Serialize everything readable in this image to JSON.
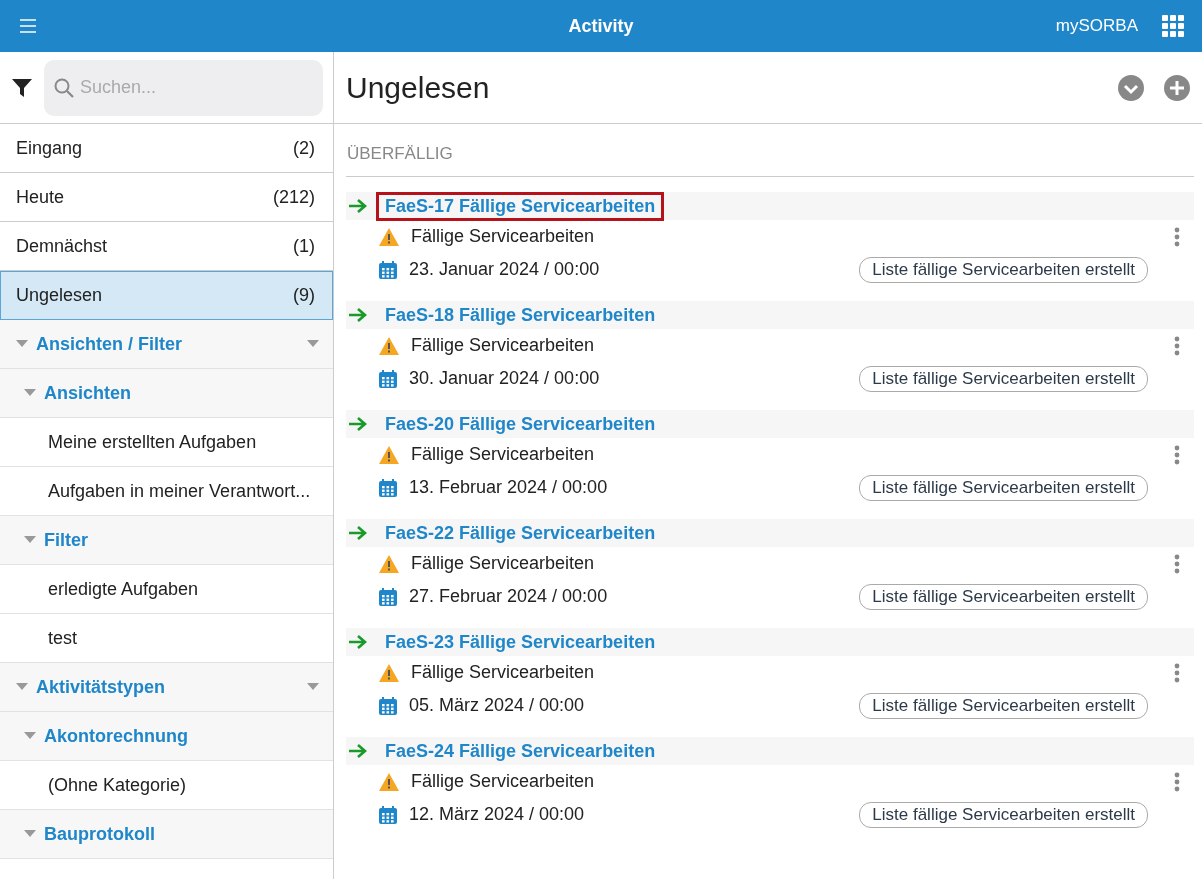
{
  "topbar": {
    "title": "Activity",
    "brand": "mySORBA"
  },
  "sidebar": {
    "search": {
      "placeholder": "Suchen..."
    },
    "items": [
      {
        "label": "Eingang",
        "count": "(2)",
        "selected": false
      },
      {
        "label": "Heute",
        "count": "(212)",
        "selected": false
      },
      {
        "label": "Demnächst",
        "count": "(1)",
        "selected": false
      },
      {
        "label": "Ungelesen",
        "count": "(9)",
        "selected": true
      }
    ],
    "tree": [
      {
        "label": "Ansichten / Filter",
        "expanded": true,
        "children": [
          {
            "label": "Ansichten",
            "expanded": true,
            "children": [
              {
                "label": "Meine erstellten Aufgaben"
              },
              {
                "label": "Aufgaben in meiner Verantwort..."
              }
            ]
          },
          {
            "label": "Filter",
            "expanded": true,
            "children": [
              {
                "label": "erledigte Aufgaben"
              },
              {
                "label": "test"
              }
            ]
          }
        ]
      },
      {
        "label": "Aktivitätstypen",
        "expanded": true,
        "children": [
          {
            "label": "Akontorechnung",
            "expanded": true,
            "children": [
              {
                "label": "(Ohne Kategorie)"
              }
            ]
          },
          {
            "label": "Bauprotokoll",
            "expanded": true
          }
        ]
      }
    ]
  },
  "content": {
    "title": "Ungelesen",
    "section": "ÜBERFÄLLIG",
    "activities": [
      {
        "title": "FaeS-17 Fällige Servicearbeiten",
        "highlighted": true,
        "subject": "Fällige Servicearbeiten",
        "date": "23. Januar 2024 / 00:00",
        "tag": "Liste fällige Servicearbeiten erstellt"
      },
      {
        "title": "FaeS-18 Fällige Servicearbeiten",
        "highlighted": false,
        "subject": "Fällige Servicearbeiten",
        "date": "30. Januar 2024 / 00:00",
        "tag": "Liste fällige Servicearbeiten erstellt"
      },
      {
        "title": "FaeS-20 Fällige Servicearbeiten",
        "highlighted": false,
        "subject": "Fällige Servicearbeiten",
        "date": "13. Februar 2024 / 00:00",
        "tag": "Liste fällige Servicearbeiten erstellt"
      },
      {
        "title": "FaeS-22 Fällige Servicearbeiten",
        "highlighted": false,
        "subject": "Fällige Servicearbeiten",
        "date": "27. Februar 2024 / 00:00",
        "tag": "Liste fällige Servicearbeiten erstellt"
      },
      {
        "title": "FaeS-23 Fällige Servicearbeiten",
        "highlighted": false,
        "subject": "Fällige Servicearbeiten",
        "date": "05. März 2024 / 00:00",
        "tag": "Liste fällige Servicearbeiten erstellt"
      },
      {
        "title": "FaeS-24 Fällige Servicearbeiten",
        "highlighted": false,
        "subject": "Fällige Servicearbeiten",
        "date": "12. März 2024 / 00:00",
        "tag": "Liste fällige Servicearbeiten erstellt"
      }
    ]
  }
}
